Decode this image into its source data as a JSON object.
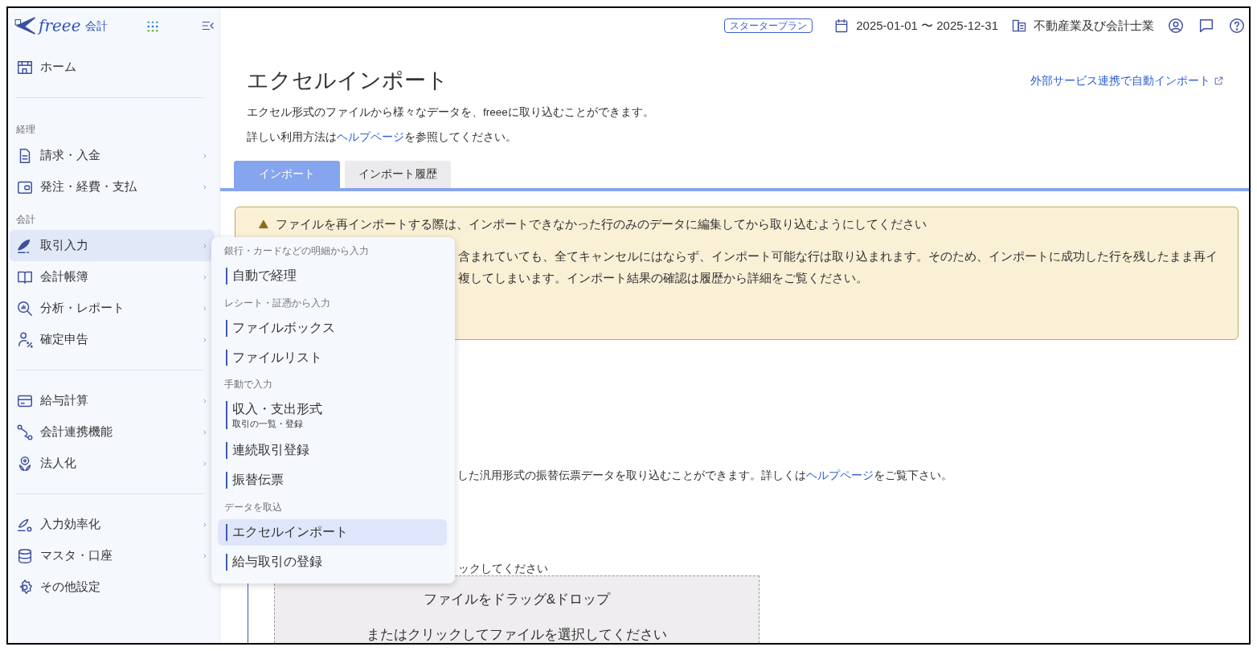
{
  "sidebar": {
    "logo": {
      "brand": "freee",
      "product": "会計"
    },
    "items": [
      {
        "kind": "link",
        "label": "ホーム",
        "has_submenu": false,
        "selected": false
      },
      {
        "kind": "divider"
      },
      {
        "kind": "section",
        "label": "経理"
      },
      {
        "kind": "link",
        "label": "請求・入金",
        "has_submenu": true,
        "selected": false
      },
      {
        "kind": "link",
        "label": "発注・経費・支払",
        "has_submenu": true,
        "selected": false
      },
      {
        "kind": "section",
        "label": "会計"
      },
      {
        "kind": "link",
        "label": "取引入力",
        "has_submenu": true,
        "selected": true
      },
      {
        "kind": "link",
        "label": "会計帳簿",
        "has_submenu": true,
        "selected": false
      },
      {
        "kind": "link",
        "label": "分析・レポート",
        "has_submenu": true,
        "selected": false
      },
      {
        "kind": "link",
        "label": "確定申告",
        "has_submenu": true,
        "selected": false
      },
      {
        "kind": "divider"
      },
      {
        "kind": "link",
        "label": "給与計算",
        "has_submenu": true,
        "selected": false
      },
      {
        "kind": "link",
        "label": "会計連携機能",
        "has_submenu": true,
        "selected": false
      },
      {
        "kind": "link",
        "label": "法人化",
        "has_submenu": true,
        "selected": false
      },
      {
        "kind": "divider"
      },
      {
        "kind": "link",
        "label": "入力効率化",
        "has_submenu": true,
        "selected": false
      },
      {
        "kind": "link",
        "label": "マスタ・口座",
        "has_submenu": true,
        "selected": false
      },
      {
        "kind": "link",
        "label": "その他設定",
        "has_submenu": false,
        "selected": false
      }
    ]
  },
  "flyout": {
    "groups": [
      {
        "heading": "銀行・カードなどの明細から入力",
        "items": [
          {
            "label": "自動で経理",
            "selected": false
          }
        ]
      },
      {
        "heading": "レシート・証憑から入力",
        "items": [
          {
            "label": "ファイルボックス",
            "selected": false
          },
          {
            "label": "ファイルリスト",
            "selected": false
          }
        ]
      },
      {
        "heading": "手動で入力",
        "items": [
          {
            "label": "収入・支出形式",
            "sublabel": "取引の一覧・登録",
            "selected": false
          },
          {
            "label": "連続取引登録",
            "selected": false
          },
          {
            "label": "振替伝票",
            "selected": false
          }
        ]
      },
      {
        "heading": "データを取込",
        "items": [
          {
            "label": "エクセルインポート",
            "selected": true
          },
          {
            "label": "給与取引の登録",
            "selected": false
          }
        ]
      }
    ]
  },
  "header": {
    "plan": "スタータープラン",
    "period": "2025-01-01 〜 2025-12-31",
    "company": "不動産業及び会計士業"
  },
  "page": {
    "title": "エクセルインポート",
    "external_link": "外部サービス連携で自動インポート",
    "description": "エクセル形式のファイルから様々なデータを、freeeに取り込むことができます。",
    "help_line": {
      "before": "詳しい利用方法は",
      "link": "ヘルプページ",
      "after": "を参照してください。"
    },
    "tabs": [
      {
        "label": "インポート",
        "selected": true
      },
      {
        "label": "インポート履歴",
        "selected": false
      }
    ],
    "warning": {
      "title": "ファイルを再インポートする際は、インポートできなかった行のみのデータに編集してから取り込むようにしてください",
      "lines": [
        "含まれていても、全てキャンセルにはならず、インポート可能な行は取り込まれます。そのため、インポートに成功した行を残したまま再イ",
        "複してしまいます。インポート結果の確認は履歴から詳細をご覧ください。"
      ]
    },
    "section_text": {
      "before": "した汎用形式の振替伝票データを取り込むことができます。詳しくは",
      "link": "ヘルプページ",
      "after": "をご覧下さい。"
    },
    "drop_hint": "ックしてください",
    "dropzone": {
      "lines": [
        "ファイルをドラッグ&ドロップ",
        "またはクリックしてファイルを選択してください"
      ]
    }
  }
}
